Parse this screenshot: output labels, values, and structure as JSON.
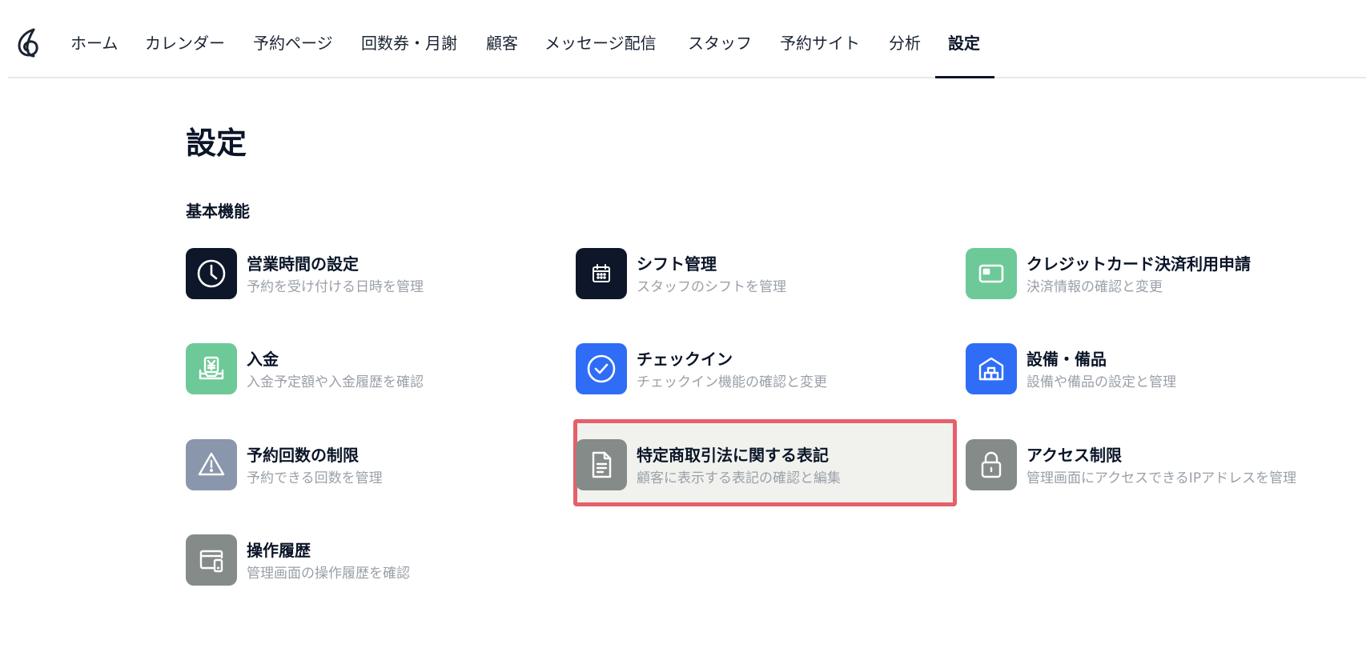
{
  "nav": {
    "items": [
      {
        "label": "ホーム"
      },
      {
        "label": "カレンダー"
      },
      {
        "label": "予約ページ"
      },
      {
        "label": "回数券・月謝"
      },
      {
        "label": "顧客"
      },
      {
        "label": "メッセージ配信"
      },
      {
        "label": "スタッフ"
      },
      {
        "label": "予約サイト"
      },
      {
        "label": "分析"
      },
      {
        "label": "設定"
      }
    ],
    "active": "設定"
  },
  "page": {
    "title": "設定",
    "section": "基本機能"
  },
  "cards": [
    {
      "title": "営業時間の設定",
      "desc": "予約を受け付ける日時を管理",
      "icon": "clock-icon",
      "color": "#0e1729"
    },
    {
      "title": "シフト管理",
      "desc": "スタッフのシフトを管理",
      "icon": "calendar-icon",
      "color": "#0e1729"
    },
    {
      "title": "クレジットカード決済利用申請",
      "desc": "決済情報の確認と変更",
      "icon": "credit-card-icon",
      "color": "#6dc997"
    },
    {
      "title": "入金",
      "desc": "入金予定額や入金履歴を確認",
      "icon": "yen-inbox-icon",
      "color": "#6dc997"
    },
    {
      "title": "チェックイン",
      "desc": "チェックイン機能の確認と変更",
      "icon": "check-circle-icon",
      "color": "#2f6df6"
    },
    {
      "title": "設備・備品",
      "desc": "設備や備品の設定と管理",
      "icon": "warehouse-icon",
      "color": "#2f6df6"
    },
    {
      "title": "予約回数の制限",
      "desc": "予約できる回数を管理",
      "icon": "warning-icon",
      "color": "#8a96ab"
    },
    {
      "title": "特定商取引法に関する表記",
      "desc": "顧客に表示する表記の確認と編集",
      "icon": "document-icon",
      "color": "#858b89"
    },
    {
      "title": "アクセス制限",
      "desc": "管理画面にアクセスできるIPアドレスを管理",
      "icon": "lock-icon",
      "color": "#858b89"
    },
    {
      "title": "操作履歴",
      "desc": "管理画面の操作履歴を確認",
      "icon": "devices-icon",
      "color": "#858b89"
    }
  ],
  "colors": {
    "highlight_border": "#e5606b",
    "highlight_bg": "#f1f2ee",
    "text_primary": "#0b1528",
    "text_secondary": "#9aa0a8"
  }
}
